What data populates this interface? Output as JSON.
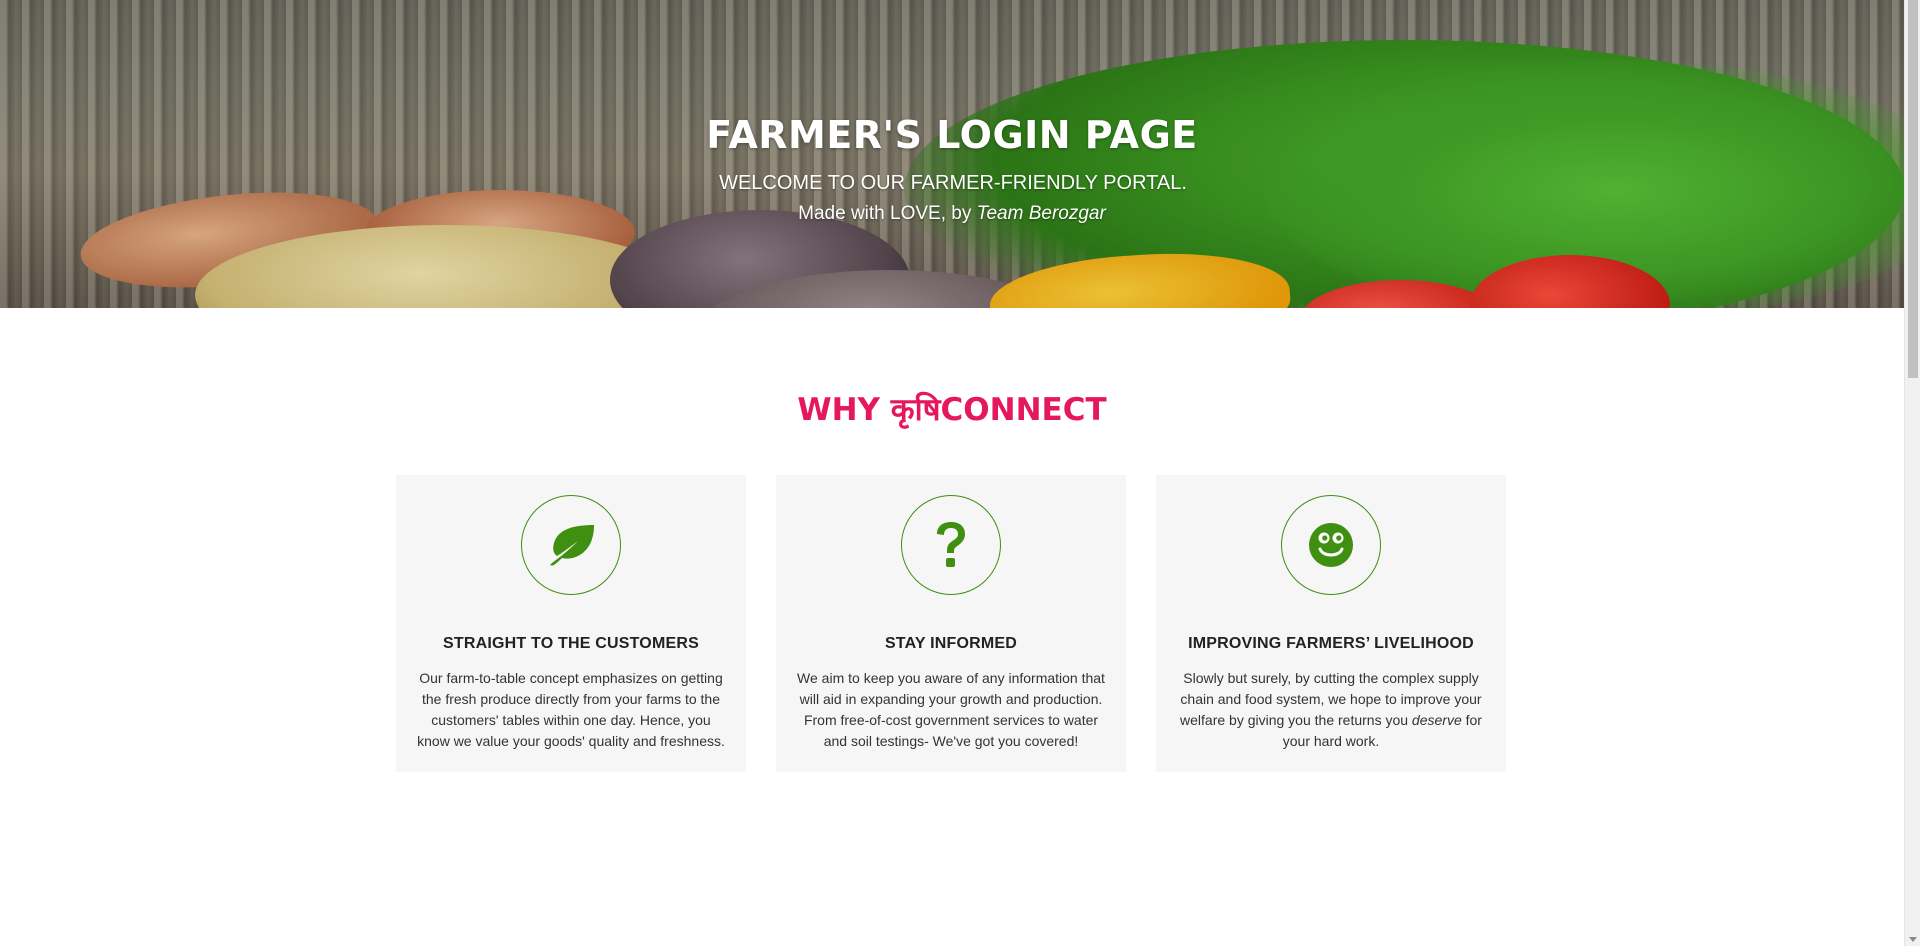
{
  "hero": {
    "title": "FARMER'S LOGIN PAGE",
    "subtitle": "WELCOME TO OUR FARMER-FRIENDLY PORTAL.",
    "credit_prefix": "Made with LOVE, by ",
    "credit_team": "Team Berozgar"
  },
  "section": {
    "title": "WHY कृषिCONNECT"
  },
  "cards": [
    {
      "icon": "leaf-icon",
      "title": "STRAIGHT TO THE CUSTOMERS",
      "text": "Our farm-to-table concept emphasizes on getting the fresh produce directly from your farms to the customers' tables within one day. Hence, you know we value your goods' quality and freshness."
    },
    {
      "icon": "question-icon",
      "title": "STAY INFORMED",
      "text": "We aim to keep you aware of any information that will aid in expanding your growth and production. From free-of-cost government services to water and soil testings- We've got you covered!"
    },
    {
      "icon": "smiley-icon",
      "title": "IMPROVING FARMERS’ LIVELIHOOD",
      "text_before": "Slowly but surely, by cutting the complex supply chain and food system, we hope to improve your welfare by giving you the returns you ",
      "text_emphasis": "deserve",
      "text_after": " for your hard work."
    }
  ],
  "colors": {
    "accent": "#e6185c",
    "icon_green": "#3f8f11",
    "card_bg": "#f6f6f6"
  }
}
